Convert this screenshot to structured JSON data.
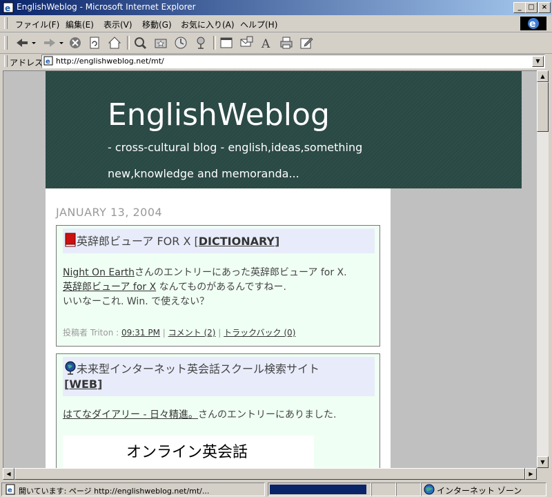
{
  "window": {
    "title": "EnglishWeblog - Microsoft Internet Explorer"
  },
  "menu": [
    "ファイル(F)",
    "編集(E)",
    "表示(V)",
    "移動(G)",
    "お気に入り(A)",
    "ヘルプ(H)"
  ],
  "address": {
    "label": "アドレス",
    "url": "http://englishweblog.net/mt/"
  },
  "page": {
    "site_title": "EnglishWeblog",
    "site_description": "- cross-cultural blog -   english,ideas,something new,knowledge and memoranda...",
    "date_header": "JANUARY 13, 2004",
    "entries": [
      {
        "title": "英辞郎ビューア FOR X [",
        "category": "DICTIONARY",
        "title_end": "]",
        "link1": "Night On Earth",
        "line1_rest": "さんのエントリーにあった英辞郎ビューア for X.",
        "link2": "英辞郎ビューア for X",
        "line2_rest": " なんてものがあるんですねー.",
        "line3": "いいなーこれ. Win. で使えない？",
        "footer_prefix": "投稿者 Triton : ",
        "time": "09:31 PM",
        "comments": "コメント (2)",
        "trackbacks": "トラックバック (0)"
      },
      {
        "title": "未来型インターネット英会話スクール検索サイト",
        "category": "WEB",
        "link1": "はてなダイアリー - 日々精進。",
        "line1_rest": "さんのエントリーにありました.",
        "promo_text": "オンライン英会話"
      }
    ]
  },
  "status": {
    "text": "開いています: ページ http://englishweblog.net/mt/...",
    "progress": 0.97,
    "zone": "インターネット ゾーン"
  }
}
